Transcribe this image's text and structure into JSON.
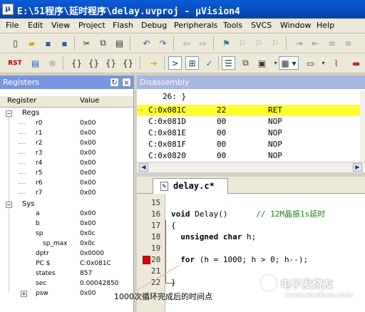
{
  "window": {
    "title": "E:\\51程序\\延时程序\\delay.uvproj - µVision4"
  },
  "menu": [
    "File",
    "Edit",
    "View",
    "Project",
    "Flash",
    "Debug",
    "Peripherals",
    "Tools",
    "SVCS",
    "Window",
    "Help"
  ],
  "toolbar": {
    "rst_label": "RST"
  },
  "registers": {
    "title": "Registers",
    "col_register": "Register",
    "col_value": "Value",
    "regs_group": "Regs",
    "sys_group": "Sys",
    "regs": [
      {
        "name": "r0",
        "value": "0x00"
      },
      {
        "name": "r1",
        "value": "0x00"
      },
      {
        "name": "r2",
        "value": "0x00"
      },
      {
        "name": "r3",
        "value": "0x00"
      },
      {
        "name": "r4",
        "value": "0x00"
      },
      {
        "name": "r5",
        "value": "0x00"
      },
      {
        "name": "r6",
        "value": "0x00"
      },
      {
        "name": "r7",
        "value": "0x00"
      }
    ],
    "sys": [
      {
        "name": "a",
        "value": "0x00"
      },
      {
        "name": "b",
        "value": "0x00"
      },
      {
        "name": "sp",
        "value": "0x0c"
      },
      {
        "name": "sp_max",
        "value": "0x0c"
      },
      {
        "name": "dptr",
        "value": "0x0000"
      },
      {
        "name": "PC  $",
        "value": "C:0x081C"
      },
      {
        "name": "states",
        "value": "857"
      },
      {
        "name": "sec",
        "value": "0.00042850"
      },
      {
        "name": "psw",
        "value": "0x00"
      }
    ]
  },
  "disassembly": {
    "title": "Disassembly",
    "source_line": "26: }",
    "rows": [
      {
        "addr": "C:0x081C",
        "opcode": "22",
        "mnemonic": "RET"
      },
      {
        "addr": "C:0x081D",
        "opcode": "00",
        "mnemonic": "NOP"
      },
      {
        "addr": "C:0x081E",
        "opcode": "00",
        "mnemonic": "NOP"
      },
      {
        "addr": "C:0x081F",
        "opcode": "00",
        "mnemonic": "NOP"
      },
      {
        "addr": "C:0x0820",
        "opcode": "00",
        "mnemonic": "NOP"
      }
    ]
  },
  "editor": {
    "tab_label": "delay.c*",
    "lines": [
      {
        "num": "15",
        "parts": []
      },
      {
        "num": "16",
        "parts": [
          {
            "t": "void",
            "c": "kw"
          },
          {
            "t": " Delay()      ",
            "c": ""
          },
          {
            "t": "// 12M晶振1s延时",
            "c": "cmt"
          }
        ]
      },
      {
        "num": "17",
        "parts": [
          {
            "t": "{",
            "c": ""
          }
        ]
      },
      {
        "num": "18",
        "parts": [
          {
            "t": "  ",
            "c": ""
          },
          {
            "t": "unsigned char",
            "c": "kw"
          },
          {
            "t": " h;",
            "c": ""
          }
        ]
      },
      {
        "num": "19",
        "parts": []
      },
      {
        "num": "20",
        "parts": [
          {
            "t": "  ",
            "c": ""
          },
          {
            "t": "for",
            "c": "kw"
          },
          {
            "t": " (h = 1000; h > 0; h--);",
            "c": ""
          }
        ]
      },
      {
        "num": "21",
        "parts": []
      },
      {
        "num": "22",
        "parts": [
          {
            "t": "}",
            "c": ""
          }
        ]
      }
    ]
  },
  "annotation": "1000次循环完成后的时间点",
  "watermark": {
    "text": "电子发烧友",
    "url": "www.elecfans.com"
  }
}
